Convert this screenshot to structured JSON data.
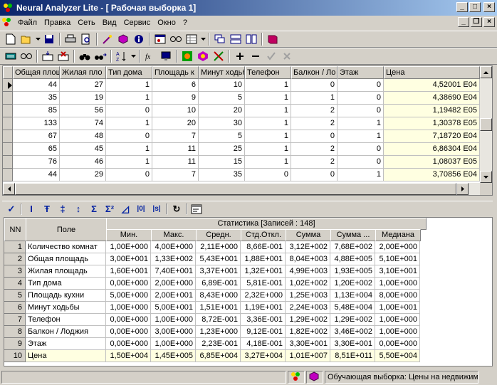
{
  "window": {
    "title": "Neural Analyzer Lite - [ Рабочая выборка 1]",
    "min_label": "_",
    "max_label": "□",
    "close_label": "×",
    "mdi_min": "_",
    "mdi_restore": "❐",
    "mdi_close": "×"
  },
  "menu": [
    "Файл",
    "Правка",
    "Сеть",
    "Вид",
    "Сервис",
    "Окно",
    "?"
  ],
  "data_grid": {
    "headers": [
      "Общая площ",
      "Жилая пло",
      "Тип дома",
      "Площадь к",
      "Минут ходьб",
      "Телефон",
      "Балкон / Ло",
      "Этаж",
      "Цена"
    ],
    "rows": [
      [
        "44",
        "27",
        "1",
        "6",
        "10",
        "1",
        "0",
        "0",
        "4,52001 E04"
      ],
      [
        "35",
        "19",
        "1",
        "9",
        "5",
        "1",
        "1",
        "0",
        "4,38690 E04"
      ],
      [
        "85",
        "56",
        "0",
        "10",
        "20",
        "1",
        "2",
        "0",
        "1,19482 E05"
      ],
      [
        "133",
        "74",
        "1",
        "20",
        "30",
        "1",
        "2",
        "1",
        "1,30378 E05"
      ],
      [
        "67",
        "48",
        "0",
        "7",
        "5",
        "1",
        "0",
        "1",
        "7,18720 E04"
      ],
      [
        "65",
        "45",
        "1",
        "11",
        "25",
        "1",
        "2",
        "0",
        "6,86304 E04"
      ],
      [
        "76",
        "46",
        "1",
        "11",
        "15",
        "1",
        "2",
        "0",
        "1,08037 E05"
      ],
      [
        "44",
        "29",
        "0",
        "7",
        "35",
        "0",
        "0",
        "1",
        "3,70856 E04"
      ]
    ]
  },
  "stats": {
    "nn_label": "NN",
    "field_label": "Поле",
    "group_label": "Статистика [Записей : 148]",
    "columns": [
      "Мин.",
      "Макс.",
      "Средн.",
      "Стд.Откл.",
      "Сумма",
      "Сумма ...",
      "Медиана"
    ],
    "rows": [
      {
        "n": "1",
        "field": "Количество комнат",
        "vals": [
          "1,00E+000",
          "4,00E+000",
          "2,11E+000",
          "8,66E-001",
          "3,12E+002",
          "7,68E+002",
          "2,00E+000"
        ]
      },
      {
        "n": "2",
        "field": "Общая площадь",
        "vals": [
          "3,00E+001",
          "1,33E+002",
          "5,43E+001",
          "1,88E+001",
          "8,04E+003",
          "4,88E+005",
          "5,10E+001"
        ]
      },
      {
        "n": "3",
        "field": "Жилая площадь",
        "vals": [
          "1,60E+001",
          "7,40E+001",
          "3,37E+001",
          "1,32E+001",
          "4,99E+003",
          "1,93E+005",
          "3,10E+001"
        ]
      },
      {
        "n": "4",
        "field": "Тип дома",
        "vals": [
          "0,00E+000",
          "2,00E+000",
          "6,89E-001",
          "5,81E-001",
          "1,02E+002",
          "1,20E+002",
          "1,00E+000"
        ]
      },
      {
        "n": "5",
        "field": "Площадь кухни",
        "vals": [
          "5,00E+000",
          "2,00E+001",
          "8,43E+000",
          "2,32E+000",
          "1,25E+003",
          "1,13E+004",
          "8,00E+000"
        ]
      },
      {
        "n": "6",
        "field": "Минут ходьбы",
        "vals": [
          "1,00E+000",
          "5,00E+001",
          "1,51E+001",
          "1,19E+001",
          "2,24E+003",
          "5,48E+004",
          "1,00E+001"
        ]
      },
      {
        "n": "7",
        "field": "Телефон",
        "vals": [
          "0,00E+000",
          "1,00E+000",
          "8,72E-001",
          "3,36E-001",
          "1,29E+002",
          "1,29E+002",
          "1,00E+000"
        ]
      },
      {
        "n": "8",
        "field": "Балкон / Лоджия",
        "vals": [
          "0,00E+000",
          "3,00E+000",
          "1,23E+000",
          "9,12E-001",
          "1,82E+002",
          "3,46E+002",
          "1,00E+000"
        ]
      },
      {
        "n": "9",
        "field": "Этаж",
        "vals": [
          "0,00E+000",
          "1,00E+000",
          "2,23E-001",
          "4,18E-001",
          "3,30E+001",
          "3,30E+001",
          "0,00E+000"
        ]
      },
      {
        "n": "10",
        "field": "Цена",
        "vals": [
          "1,50E+004",
          "1,45E+005",
          "6,85E+004",
          "3,27E+004",
          "1,01E+007",
          "8,51E+011",
          "5,50E+004"
        ]
      }
    ]
  },
  "stat_toolbar": [
    "✓",
    "I",
    "Ŧ",
    "‡",
    "↕",
    "Σ",
    "Σ²",
    "◿",
    "|0|",
    "|s|",
    "↻"
  ],
  "status": {
    "text": "Обучающая выборка: Цены на недвижим"
  },
  "colors": {
    "title_start": "#0a246a",
    "title_end": "#a6caf0",
    "highlight": "#ffffe1",
    "face": "#d4d0c8"
  }
}
